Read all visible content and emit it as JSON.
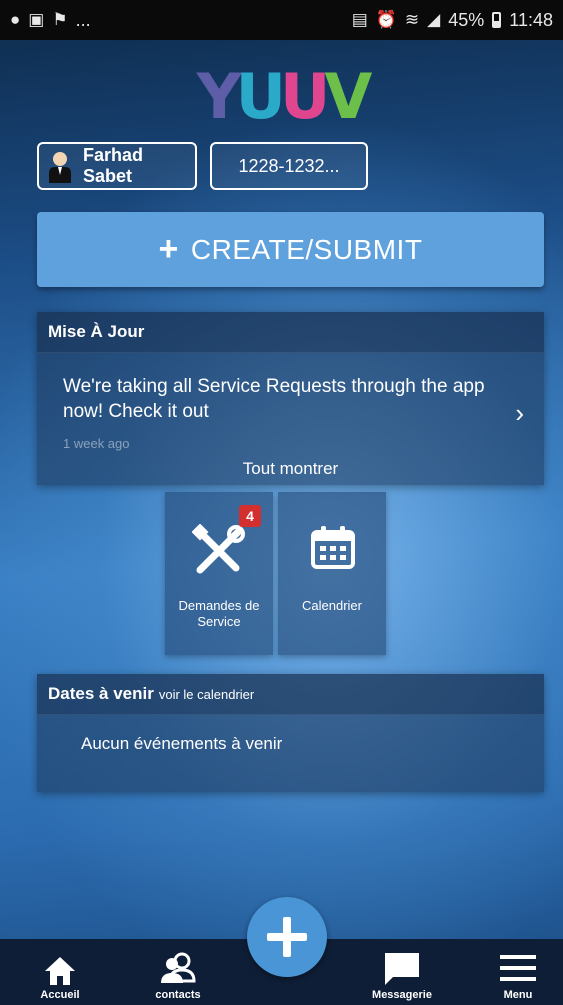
{
  "status_bar": {
    "left_ellipsis": "...",
    "battery": "45%",
    "time": "11:48"
  },
  "logo": {
    "text": "YUUV",
    "letters": [
      {
        "char": "Y",
        "color": "#5e5ea8"
      },
      {
        "char": "U",
        "color": "#2aa9c8"
      },
      {
        "char": "U",
        "color": "#e0458f"
      },
      {
        "char": "V",
        "color": "#6cc04a"
      }
    ]
  },
  "account": {
    "user_name": "Farhad Sabet",
    "site_code": "1228-1232..."
  },
  "create_button": {
    "label": "CREATE/SUBMIT"
  },
  "update_panel": {
    "title": "Mise À Jour",
    "message": "We're taking all Service Requests through the app now! Check it out",
    "time": "1 week ago",
    "show_all": "Tout montrer"
  },
  "tiles": {
    "service": {
      "label": "Demandes de Service",
      "badge": "4"
    },
    "calendar": {
      "label": "Calendrier"
    }
  },
  "dates_panel": {
    "title": "Dates à venir",
    "link": "voir le calendrier",
    "empty": "Aucun événements à venir"
  },
  "nav": {
    "home": "Accueil",
    "contacts": "contacts",
    "messages": "Messagerie",
    "menu": "Menu"
  },
  "colors": {
    "accent": "#5ea1dc",
    "badge": "#d32f2f",
    "nav_bg": "#0e1e36",
    "fab": "#4a95d6"
  }
}
